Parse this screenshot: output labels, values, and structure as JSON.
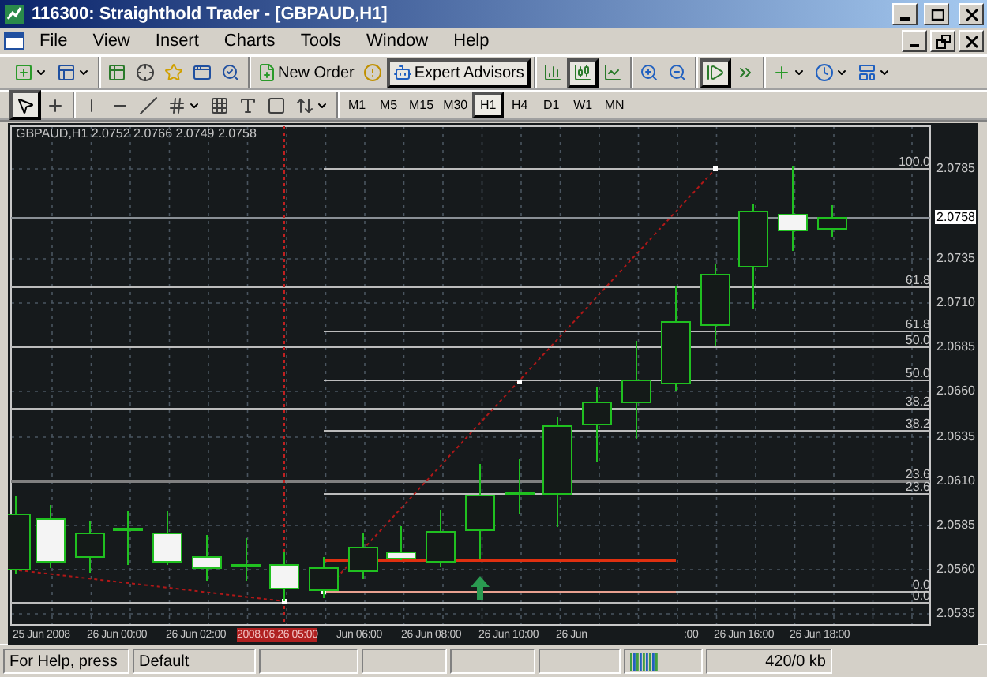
{
  "window": {
    "title": "116300: Straighthold Trader - [GBPAUD,H1]"
  },
  "menu": [
    "File",
    "View",
    "Insert",
    "Charts",
    "Tools",
    "Window",
    "Help"
  ],
  "toolbars": [
    {
      "groups": [
        [
          {
            "kind": "new-chart",
            "pressed": false
          },
          {
            "kind": "profiles",
            "pressed": false
          }
        ],
        [
          {
            "kind": "market-watch",
            "pressed": false
          },
          {
            "kind": "data-window",
            "pressed": false
          },
          {
            "kind": "navigator",
            "pressed": false
          },
          {
            "kind": "terminal",
            "pressed": false
          },
          {
            "kind": "tester",
            "pressed": false
          }
        ],
        [
          {
            "kind": "new-order",
            "label": "New Order",
            "pressed": false
          },
          {
            "kind": "alert",
            "pressed": false
          },
          {
            "kind": "experts",
            "label": "Expert Advisors",
            "pressed": true
          }
        ],
        [
          {
            "kind": "bar-chart",
            "pressed": false
          },
          {
            "kind": "candle-chart",
            "pressed": true
          },
          {
            "kind": "line-chart",
            "pressed": false
          }
        ],
        [
          {
            "kind": "zoom-in",
            "pressed": false
          },
          {
            "kind": "zoom-out",
            "pressed": false
          }
        ],
        [
          {
            "kind": "chart-shift",
            "pressed": true
          },
          {
            "kind": "auto-scroll",
            "pressed": false
          }
        ],
        [
          {
            "kind": "indicators",
            "pressed": false
          },
          {
            "kind": "periods",
            "pressed": false
          },
          {
            "kind": "templates",
            "pressed": false
          }
        ]
      ]
    },
    {
      "groups": [
        [
          {
            "kind": "cursor",
            "pressed": true
          },
          {
            "kind": "crosshair",
            "pressed": false
          }
        ],
        [
          {
            "kind": "vertical-line",
            "pressed": false
          },
          {
            "kind": "horizontal-line",
            "pressed": false
          },
          {
            "kind": "trend-line",
            "pressed": false
          },
          {
            "kind": "channels",
            "pressed": false
          },
          {
            "kind": "fibo",
            "pressed": false
          },
          {
            "kind": "text",
            "pressed": false
          },
          {
            "kind": "label",
            "pressed": false
          },
          {
            "kind": "arrows",
            "pressed": false
          }
        ]
      ]
    }
  ],
  "timeframes": [
    {
      "label": "M1",
      "selected": false
    },
    {
      "label": "M5",
      "selected": false
    },
    {
      "label": "M15",
      "selected": false
    },
    {
      "label": "M30",
      "selected": false
    },
    {
      "label": "H1",
      "selected": true
    },
    {
      "label": "H4",
      "selected": false
    },
    {
      "label": "D1",
      "selected": false
    },
    {
      "label": "W1",
      "selected": false
    },
    {
      "label": "MN",
      "selected": false
    }
  ],
  "chart": {
    "header": "GBPAUD,H1  2.0752 2.0766 2.0749 2.0758",
    "price_labels": [
      {
        "text": "2.0785",
        "kind": "tick"
      },
      {
        "text": "2.0758",
        "kind": "current"
      },
      {
        "text": "2.0735",
        "kind": "tick"
      },
      {
        "text": "2.0710",
        "kind": "tick"
      },
      {
        "text": "2.0685",
        "kind": "tick"
      },
      {
        "text": "2.0660",
        "kind": "tick"
      },
      {
        "text": "2.0635",
        "kind": "tick"
      },
      {
        "text": "2.0610",
        "kind": "tick"
      },
      {
        "text": "2.0585",
        "kind": "tick"
      },
      {
        "text": "2.0560",
        "kind": "tick"
      },
      {
        "text": "2.0535",
        "kind": "tick"
      }
    ],
    "fib_labels": [
      "100.0",
      "61.8",
      "61.8",
      "50.0",
      "50.0",
      "38.2",
      "38.2",
      "23.6",
      "23.6",
      "0.0",
      "0.0"
    ],
    "time_labels": [
      {
        "text": "25 Jun 2008",
        "kind": "tick"
      },
      {
        "text": "26 Jun 00:00",
        "kind": "tick"
      },
      {
        "text": "26 Jun 02:00",
        "kind": "tick"
      },
      {
        "text": "2008.06.26 05:00",
        "kind": "cursor"
      },
      {
        "text": "Jun 06:00",
        "kind": "tick"
      },
      {
        "text": "26 Jun 08:00",
        "kind": "tick"
      },
      {
        "text": "26 Jun 10:00",
        "kind": "tick"
      },
      {
        "text": "26 Jun",
        "kind": "tick"
      },
      {
        "text": ":00",
        "kind": "tick"
      },
      {
        "text": "26 Jun 16:00",
        "kind": "tick"
      },
      {
        "text": "26 Jun 18:00",
        "kind": "tick"
      }
    ]
  },
  "status_bar": {
    "help": "For Help, press",
    "profile": "Default",
    "traffic": "420/0 kb"
  }
}
